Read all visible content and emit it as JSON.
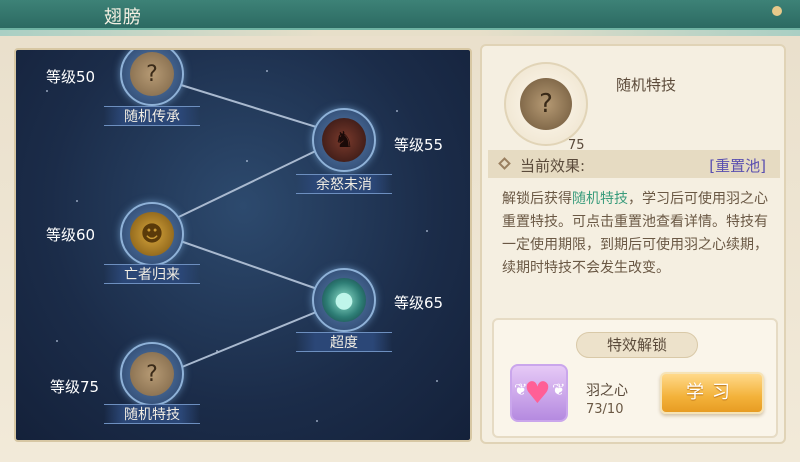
{
  "window": {
    "title": "翅膀"
  },
  "skill_tree": {
    "nodes": [
      {
        "name": "随机传承",
        "level": "等级50",
        "icon": "scroll-question-icon"
      },
      {
        "name": "余怒未消",
        "level": "等级55",
        "icon": "demon-icon"
      },
      {
        "name": "亡者归来",
        "level": "等级60",
        "icon": "ghost-icon"
      },
      {
        "name": "超度",
        "level": "等级65",
        "icon": "spirit-orb-icon"
      },
      {
        "name": "随机特技",
        "level": "等级75",
        "icon": "scroll-question-icon"
      }
    ]
  },
  "detail": {
    "skill_name": "随机特技",
    "skill_level": "75",
    "effect_label": "当前效果:",
    "reset_pool": "[重置池]",
    "description_pre": "解锁后获得",
    "description_highlight": "随机特技",
    "description_post": "，学习后可使用羽之心重置特技。可点击重置池查看详情。特技有一定使用期限，到期后可使用羽之心续期，续期时特技不会发生改变。",
    "unlock_title": "特效解锁",
    "item_name": "羽之心",
    "item_count": "73/10",
    "learn_button": "学习"
  },
  "colors": {
    "highlight": "#3a9c7c",
    "reset_link": "#5a4fb0",
    "button": "#f3b23a"
  }
}
